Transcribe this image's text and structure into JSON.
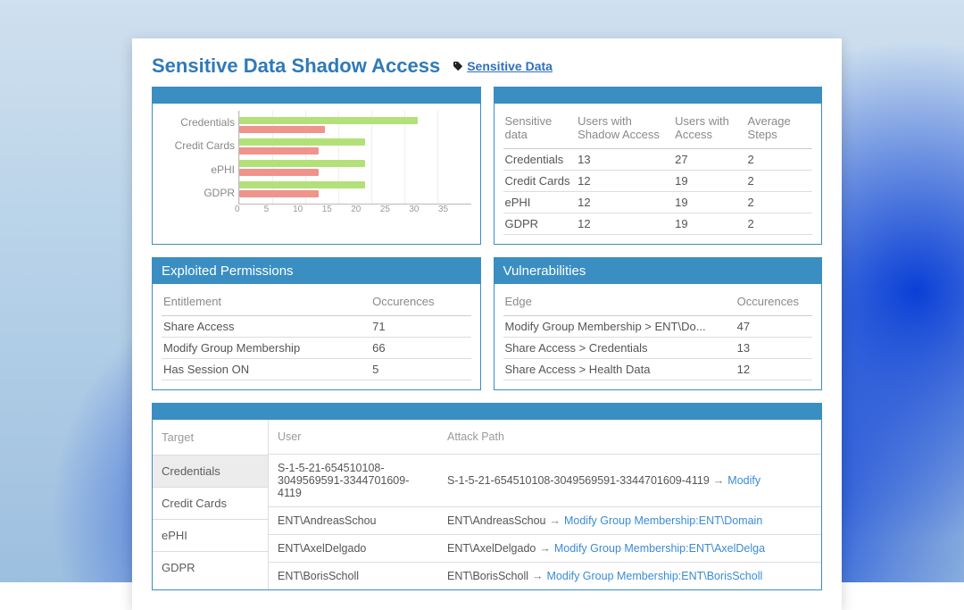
{
  "header": {
    "title": "Sensitive Data Shadow Access",
    "tag_link": "Sensitive Data"
  },
  "chart_data": {
    "type": "bar",
    "orientation": "horizontal",
    "categories": [
      "Credentials",
      "Credit Cards",
      "ePHI",
      "GDPR"
    ],
    "series": [
      {
        "name": "Users with Access",
        "color": "#b3e078",
        "values": [
          27,
          19,
          19,
          19
        ]
      },
      {
        "name": "Users with Shadow Access",
        "color": "#f0938c",
        "values": [
          13,
          12,
          12,
          12
        ]
      }
    ],
    "xlim": [
      0,
      35
    ],
    "xticks": [
      0,
      5,
      10,
      15,
      20,
      25,
      30,
      35
    ],
    "title": "",
    "xlabel": "",
    "ylabel": ""
  },
  "sensitive_table": {
    "headers": [
      "Sensitive data",
      "Users with Shadow Access",
      "Users with Access",
      "Average Steps"
    ],
    "rows": [
      [
        "Credentials",
        "13",
        "27",
        "2"
      ],
      [
        "Credit Cards",
        "12",
        "19",
        "2"
      ],
      [
        "ePHI",
        "12",
        "19",
        "2"
      ],
      [
        "GDPR",
        "12",
        "19",
        "2"
      ]
    ]
  },
  "exploited": {
    "title": "Exploited Permissions",
    "headers": [
      "Entitlement",
      "Occurences"
    ],
    "rows": [
      [
        "Share Access",
        "71"
      ],
      [
        "Modify Group Membership",
        "66"
      ],
      [
        "Has Session ON",
        "5"
      ]
    ]
  },
  "vulnerabilities": {
    "title": "Vulnerabilities",
    "headers": [
      "Edge",
      "Occurences"
    ],
    "rows": [
      [
        "Modify Group Membership > ENT\\Do...",
        "47"
      ],
      [
        "Share Access > Credentials",
        "13"
      ],
      [
        "Share Access > Health Data",
        "12"
      ]
    ]
  },
  "attack_paths": {
    "targets_header": "Target",
    "targets": [
      "Credentials",
      "Credit Cards",
      "ePHI",
      "GDPR"
    ],
    "active_target": 0,
    "headers": [
      "User",
      "Attack Path"
    ],
    "rows": [
      {
        "user": "S-1-5-21-654510108-3049569591-3344701609-4119",
        "path_prefix": "S-1-5-21-654510108-3049569591-3344701609-4119",
        "path_link": "Modify"
      },
      {
        "user": "ENT\\AndreasSchou",
        "path_prefix": "ENT\\AndreasSchou",
        "path_link": "Modify Group Membership:ENT\\Domain"
      },
      {
        "user": "ENT\\AxelDelgado",
        "path_prefix": "ENT\\AxelDelgado",
        "path_link": "Modify Group Membership:ENT\\AxelDelga"
      },
      {
        "user": "ENT\\BorisScholl",
        "path_prefix": "ENT\\BorisScholl",
        "path_link": "Modify Group Membership:ENT\\BorisScholl"
      }
    ]
  }
}
